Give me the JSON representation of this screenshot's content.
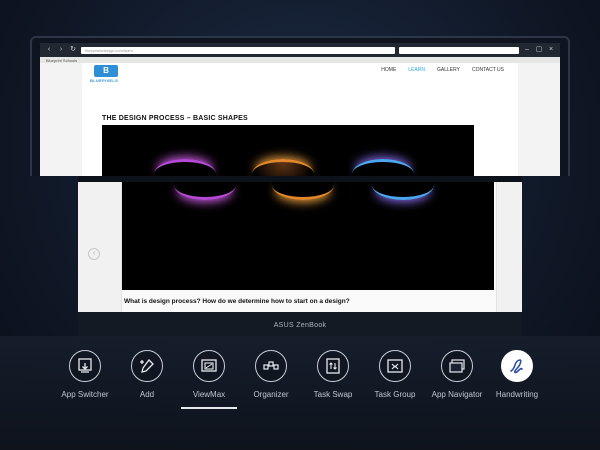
{
  "browser": {
    "url_text": "blueprintsdesign.com/learn",
    "tab_title": "Blueprint Schools"
  },
  "website": {
    "logo_text": "B",
    "name": "BLUEPIXELS",
    "nav": [
      "HOME",
      "LEARN",
      "GALLERY",
      "CONTACT US"
    ],
    "active_nav": "LEARN",
    "article_title": "THE DESIGN PROCESS – BASIC SHAPES",
    "question": "What is design process? How do we determine how to start on a design?"
  },
  "laptop": {
    "brand": "ASUS ZenBook"
  },
  "launcher": {
    "items": [
      {
        "label": "App Switcher",
        "icon": "app-switcher-icon"
      },
      {
        "label": "Add",
        "icon": "add-icon"
      },
      {
        "label": "ViewMax",
        "icon": "viewmax-icon"
      },
      {
        "label": "Organizer",
        "icon": "organizer-icon"
      },
      {
        "label": "Task Swap",
        "icon": "task-swap-icon"
      },
      {
        "label": "Task Group",
        "icon": "task-group-icon"
      },
      {
        "label": "App Navigator",
        "icon": "app-navigator-icon"
      },
      {
        "label": "Handwriting",
        "icon": "handwriting-icon"
      }
    ],
    "selected": "ViewMax",
    "active": "Handwriting"
  },
  "colors": {
    "accent_blue": "#2ea7e0",
    "orb_colors": [
      "#b64ad6",
      "#e0882b",
      "#4fa6f0"
    ]
  }
}
